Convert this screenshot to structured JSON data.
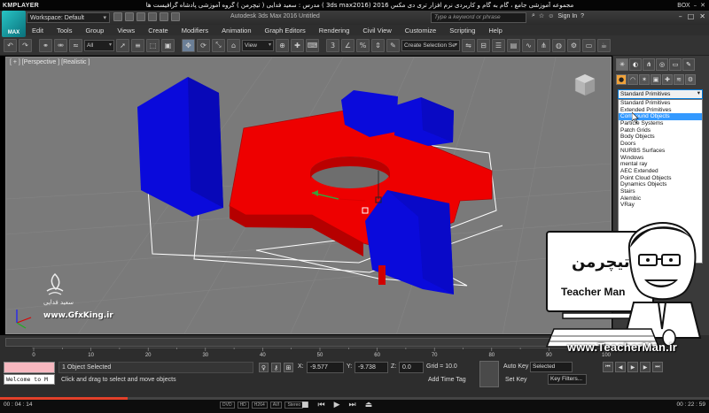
{
  "player": {
    "logo": "KMPLAYER",
    "title": "مجموعه آموزشی جامع ، گام به گام و کاربردی نرم افزار تری دی مکس 2016 (3ds max2016 ) مدرس : سعید فدایی ( تیچرمن ) گروه آموزشی پادشاه گرافیست ها",
    "box_label": "BOX"
  },
  "max_title": {
    "logo_label": "MAX",
    "workspace": "Workspace: Default",
    "app_title": "Autodesk 3ds Max 2016    Untitled",
    "search_placeholder": "Type a keyword or phrase",
    "sign_in": "Sign In"
  },
  "menu": [
    "Edit",
    "Tools",
    "Group",
    "Views",
    "Create",
    "Modifiers",
    "Animation",
    "Graph Editors",
    "Rendering",
    "Civil View",
    "Customize",
    "Scripting",
    "Help"
  ],
  "toolbar": {
    "filter_select": "All",
    "refcoord_select": "View",
    "selection_set": "Create Selection Se"
  },
  "viewport": {
    "label": "[ + ] [Perspective ] [Realistic ]",
    "watermark_name": "سعید فدایی",
    "watermark_site": "www.GfxKing.ir",
    "colors": {
      "background": "#7a7a7a",
      "red": "#ee0000",
      "blue": "#0a0adb"
    }
  },
  "command_panel": {
    "selected": "Standard Primitives",
    "options": [
      "Standard Primitives",
      "Extended Primitives",
      "Compound Objects",
      "Particle Systems",
      "Patch Grids",
      "Body Objects",
      "Doors",
      "NURBS Surfaces",
      "Windows",
      "mental ray",
      "AEC Extended",
      "Point Cloud Objects",
      "Dynamics Objects",
      "Stairs",
      "Alembic",
      "VRay"
    ],
    "highlighted_index": 2
  },
  "status": {
    "welcome": "Welcome to M",
    "selection": "1 Object Selected",
    "prompt": "Click and drag to select and move objects",
    "x_label": "X:",
    "x_value": "-9.577",
    "y_label": "Y:",
    "y_value": "-9.738",
    "z_label": "Z:",
    "z_value": "0.0",
    "grid": "Grid = 10.0",
    "add_time_tag": "Add Time Tag",
    "auto_key": "Auto Key",
    "auto_key_select": "Selected",
    "set_key": "Set Key",
    "key_filters": "Key Filters...",
    "timeline_ticks": [
      "0",
      "10",
      "20",
      "30",
      "40",
      "50",
      "60",
      "70",
      "80",
      "90",
      "100"
    ]
  },
  "player_bottom": {
    "time_left": "00 : 04 : 14",
    "time_right": "00 : 22 : 59",
    "progress": 0.18,
    "tags": [
      "DVD",
      "HD",
      "H264",
      "AVI",
      "Stereo"
    ]
  },
  "teacher": {
    "brand_fa": "تیچرمن",
    "brand_en": "Teacher Man",
    "url": "www.TeacherMan.ir"
  }
}
